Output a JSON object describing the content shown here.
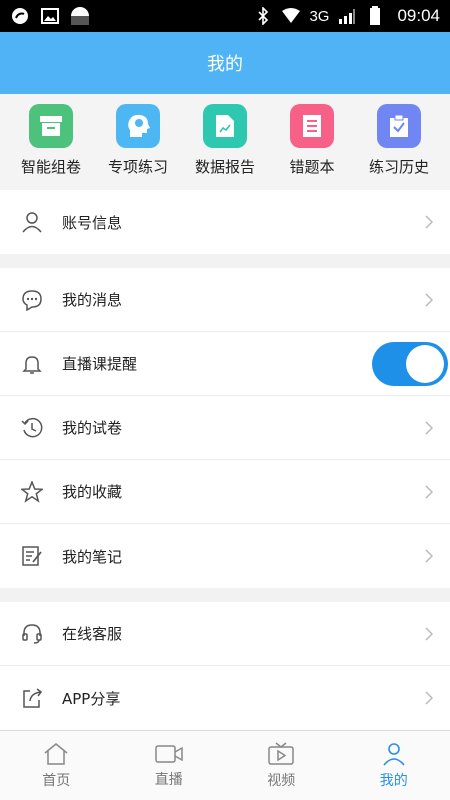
{
  "status_bar": {
    "network": "3G",
    "time": "09:04"
  },
  "header": {
    "title": "我的"
  },
  "quick_actions": [
    {
      "label": "智能组卷",
      "icon": "archive-box-icon",
      "color": "#4cc27c"
    },
    {
      "label": "专项练习",
      "icon": "head-idea-icon",
      "color": "#4cb7f3"
    },
    {
      "label": "数据报告",
      "icon": "report-chart-icon",
      "color": "#2ec8b0"
    },
    {
      "label": "错题本",
      "icon": "notebook-icon",
      "color": "#f76188"
    },
    {
      "label": "练习历史",
      "icon": "history-clipboard-icon",
      "color": "#6f86f3"
    }
  ],
  "menu": {
    "account": {
      "label": "账号信息",
      "icon": "user-icon"
    },
    "messages": {
      "label": "我的消息",
      "icon": "chat-bubble-icon"
    },
    "live_reminder": {
      "label": "直播课提醒",
      "icon": "bell-icon",
      "enabled": true
    },
    "papers": {
      "label": "我的试卷",
      "icon": "clock-history-icon"
    },
    "favorites": {
      "label": "我的收藏",
      "icon": "star-icon"
    },
    "notes": {
      "label": "我的笔记",
      "icon": "note-edit-icon"
    },
    "support": {
      "label": "在线客服",
      "icon": "headset-icon"
    },
    "share": {
      "label": "APP分享",
      "icon": "share-icon"
    }
  },
  "tabbar": [
    {
      "label": "首页",
      "icon": "home-icon"
    },
    {
      "label": "直播",
      "icon": "video-camera-icon"
    },
    {
      "label": "视频",
      "icon": "tv-play-icon"
    },
    {
      "label": "我的",
      "icon": "user-icon",
      "active": true
    }
  ],
  "colors": {
    "accent": "#4fb3f6",
    "toggle_on": "#1e90e8",
    "tab_active": "#2a8fe6"
  }
}
